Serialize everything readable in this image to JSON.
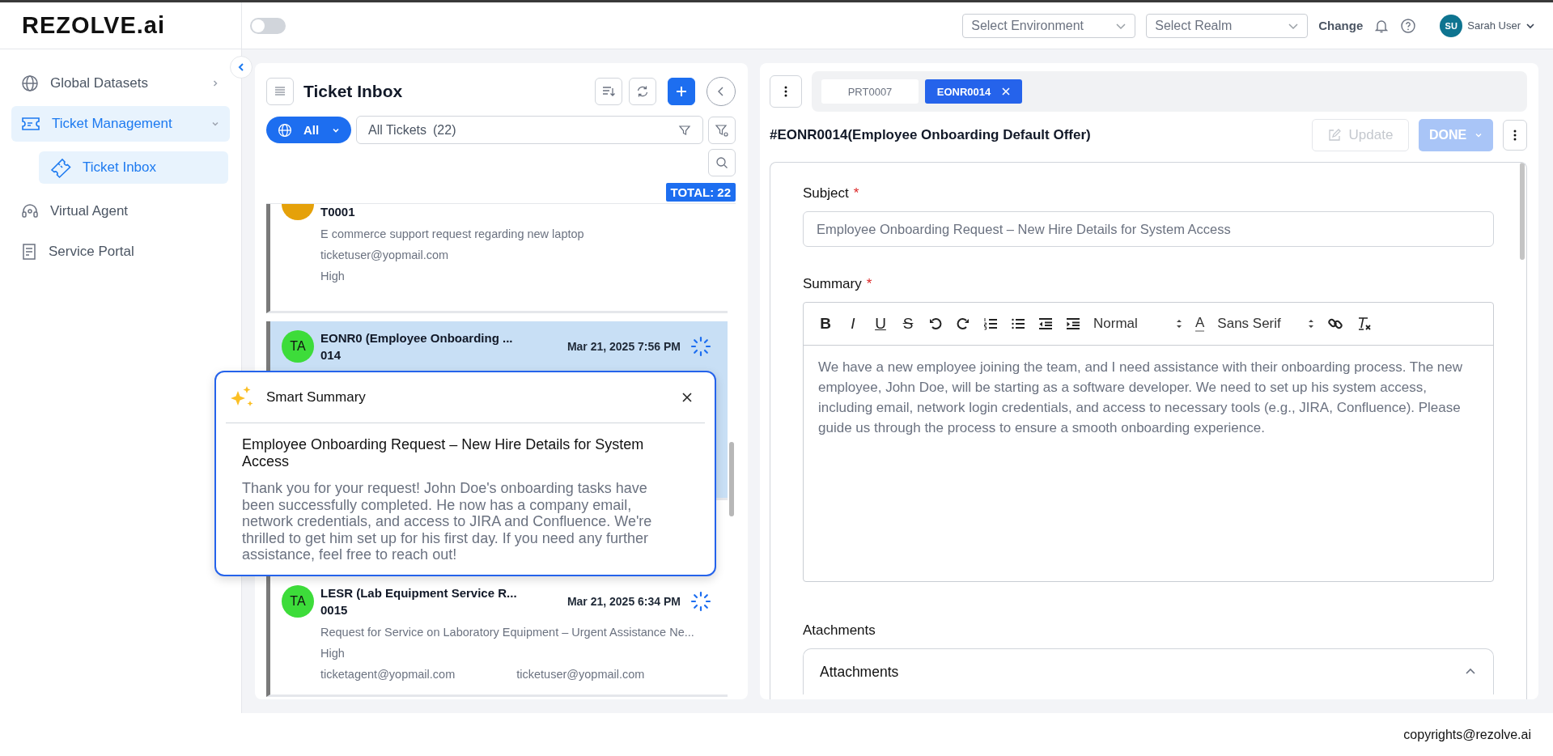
{
  "header": {
    "logo": "REZOLVE.ai",
    "toggle": {
      "on": false
    },
    "environment_select": {
      "placeholder": "Select Environment"
    },
    "realm_select": {
      "placeholder": "Select Realm"
    },
    "change_link": "Change",
    "user": {
      "initials": "SU",
      "name": "Sarah User"
    }
  },
  "sidebar": {
    "items": [
      {
        "label": "Global Datasets",
        "kind": "group",
        "selected": false,
        "expanded": false
      },
      {
        "label": "Ticket Management",
        "kind": "group",
        "selected": true,
        "expanded": true,
        "children": [
          {
            "label": "Ticket Inbox",
            "selected": true
          }
        ]
      },
      {
        "label": "Virtual Agent",
        "kind": "link",
        "selected": false
      },
      {
        "label": "Service Portal",
        "kind": "link",
        "selected": false
      }
    ]
  },
  "inbox": {
    "title": "Ticket Inbox",
    "scope": "All",
    "filter": "All Tickets",
    "count": "(22)",
    "total": "TOTAL: 22",
    "tickets": [
      {
        "number": "T0001",
        "description": "E commerce support request regarding new laptop",
        "requester": "ticketuser@yopmail.com",
        "priority": "High",
        "selected": false,
        "color": "#e5a10a"
      },
      {
        "initials": "TA",
        "title": "EONR0 (Employee Onboarding ...",
        "number": "014",
        "date": "Mar 21, 2025 7:56 PM",
        "selected": true,
        "color": "#3ddc3a"
      },
      {
        "initials": "TA",
        "title": "LESR  (Lab Equipment Service R...",
        "number": "0015",
        "date": "Mar 21, 2025 6:34 PM",
        "description": "Request for Service on Laboratory Equipment – Urgent Assistance Ne...",
        "priority": "High",
        "agent": "ticketagent@yopmail.com",
        "requester": "ticketuser@yopmail.com",
        "selected": false,
        "color": "#3ddc3a"
      }
    ]
  },
  "smart_summary": {
    "title": "Smart Summary",
    "heading": "Employee Onboarding Request – New Hire Details for System Access",
    "body": "Thank you for your request! John Doe's onboarding tasks have been successfully completed. He now has a company email, network credentials, and access to JIRA and Confluence. We're thrilled to get him set up for his first day. If you need any further assistance, feel free to reach out!"
  },
  "detail": {
    "tabs": [
      {
        "label": "PRT0007",
        "selected": false
      },
      {
        "label": "EONR0014",
        "selected": true
      }
    ],
    "title": "#EONR0014(Employee Onboarding Default Offer)",
    "update_button": {
      "label": "Update",
      "disabled": true
    },
    "done_button": {
      "label": "DONE",
      "disabled": true
    },
    "subject": {
      "label": "Subject",
      "required_mark": "*",
      "value": "Employee Onboarding Request – New Hire Details for System Access"
    },
    "summary": {
      "label": "Summary",
      "required_mark": "*",
      "format_buttons": [
        "B",
        "I",
        "U",
        "S"
      ],
      "header_select": "Normal",
      "color_button": "A",
      "font_select": "Sans Serif",
      "text": "We have a new employee joining the team, and I need assistance with their onboarding process. The new employee, John Doe, will be starting as a software developer. We need to set up his system access, including email, network login credentials, and access to necessary tools (e.g., JIRA, Confluence). Please guide us through the process to ensure a smooth onboarding experience."
    },
    "attachments": {
      "label": "Atachments",
      "panel_title": "Attachments",
      "expanded": true
    }
  },
  "footer": "copyrights@rezolve.ai"
}
